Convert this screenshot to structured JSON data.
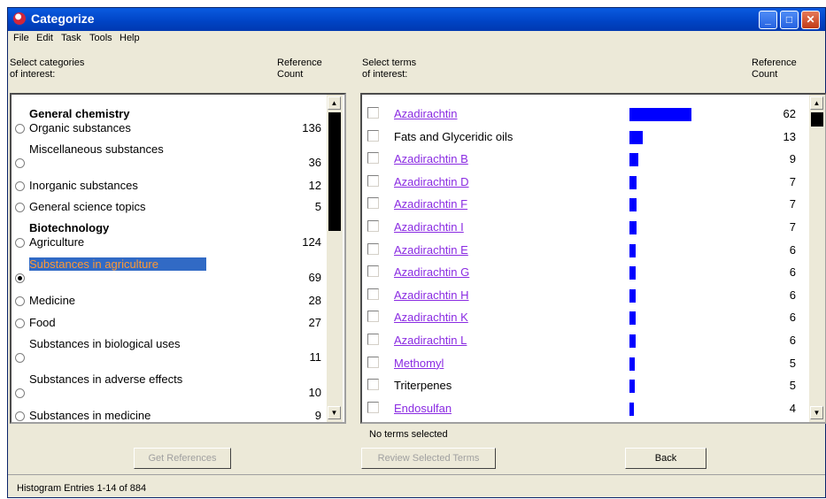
{
  "window": {
    "title": "Categorize"
  },
  "menu": [
    "File",
    "Edit",
    "Task",
    "Tools",
    "Help"
  ],
  "left_panel": {
    "header_select": "Select categories\nof interest:",
    "header_count": "Reference\nCount",
    "groups": [
      {
        "heading": "General chemistry"
      },
      {
        "heading": "Biotechnology"
      }
    ],
    "items": [
      {
        "label": "Organic substances",
        "count": "136",
        "selected": false
      },
      {
        "label": "Miscellaneous substances",
        "count": "36",
        "selected": false
      },
      {
        "label": "Inorganic substances",
        "count": "12",
        "selected": false
      },
      {
        "label": "General science topics",
        "count": "5",
        "selected": false
      },
      {
        "label": "Agriculture",
        "count": "124",
        "selected": false
      },
      {
        "label": "Substances in agriculture",
        "count": "69",
        "selected": true
      },
      {
        "label": "Medicine",
        "count": "28",
        "selected": false
      },
      {
        "label": "Food",
        "count": "27",
        "selected": false
      },
      {
        "label": "Substances in biological uses",
        "count": "11",
        "selected": false
      },
      {
        "label": "Substances in adverse effects",
        "count": "10",
        "selected": false
      },
      {
        "label": "Substances in medicine",
        "count": "9",
        "selected": false
      }
    ]
  },
  "right_panel": {
    "header_select": "Select terms\nof interest:",
    "header_count": "Reference\nCount",
    "terms": [
      {
        "label": "Azadirachtin",
        "count": 62,
        "link": true
      },
      {
        "label": "Fats and Glyceridic oils",
        "count": 13,
        "link": false
      },
      {
        "label": "Azadirachtin B",
        "count": 9,
        "link": true
      },
      {
        "label": "Azadirachtin D",
        "count": 7,
        "link": true
      },
      {
        "label": "Azadirachtin F",
        "count": 7,
        "link": true
      },
      {
        "label": "Azadirachtin I",
        "count": 7,
        "link": true
      },
      {
        "label": "Azadirachtin E",
        "count": 6,
        "link": true
      },
      {
        "label": "Azadirachtin G",
        "count": 6,
        "link": true
      },
      {
        "label": "Azadirachtin H",
        "count": 6,
        "link": true
      },
      {
        "label": "Azadirachtin K",
        "count": 6,
        "link": true
      },
      {
        "label": "Azadirachtin L",
        "count": 6,
        "link": true
      },
      {
        "label": "Methomyl",
        "count": 5,
        "link": true
      },
      {
        "label": "Triterpenes",
        "count": 5,
        "link": false
      },
      {
        "label": "Endosulfan",
        "count": 4,
        "link": true
      }
    ]
  },
  "selection_status": "No terms selected",
  "buttons": {
    "get_references": "Get References",
    "review_selected": "Review Selected Terms",
    "back": "Back"
  },
  "status_bar": "Histogram Entries 1-14 of 884",
  "colors": {
    "bar": "#0000ff",
    "link": "#8a2be2",
    "selection_bg": "#316ac5",
    "selection_text": "#ff9933"
  }
}
